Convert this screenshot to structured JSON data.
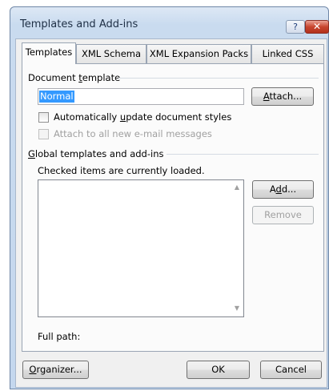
{
  "window": {
    "title": "Templates and Add-ins",
    "help_glyph": "?",
    "close_glyph": "✕"
  },
  "tabs": [
    {
      "label": "Templates",
      "active": true
    },
    {
      "label": "XML Schema",
      "active": false
    },
    {
      "label": "XML Expansion Packs",
      "active": false
    },
    {
      "label": "Linked CSS",
      "active": false
    }
  ],
  "document_template": {
    "group_label_pre": "Document ",
    "group_label_key": "t",
    "group_label_post": "emplate",
    "value": "Normal",
    "attach_label_key": "A",
    "attach_label_post": "ttach...",
    "auto_update": {
      "pre": "Automatically ",
      "key": "u",
      "post": "pdate document styles",
      "checked": false
    },
    "attach_email": {
      "label": "Attach to all new e-mail messages",
      "checked": false,
      "enabled": false
    }
  },
  "global": {
    "group_label_key": "G",
    "group_label_post": "lobal templates and add-ins",
    "note": "Checked items are currently loaded.",
    "items": [],
    "add_label_pre": "A",
    "add_label_key": "d",
    "add_label_post": "d...",
    "remove_label": "Remove",
    "full_path_label": "Full path:",
    "full_path_value": ""
  },
  "footer": {
    "organizer_key": "O",
    "organizer_post": "rganizer...",
    "ok_label": "OK",
    "cancel_label": "Cancel"
  },
  "colors": {
    "selection": "#3399ff",
    "frame": "#c4d7ee",
    "close": "#c8462f"
  }
}
